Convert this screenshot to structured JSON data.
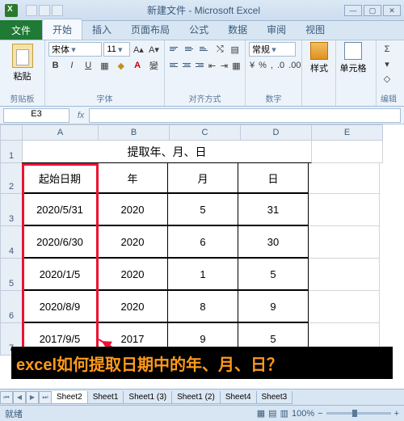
{
  "title": "新建文件 - Microsoft Excel",
  "tabs": {
    "file": "文件",
    "home": "开始",
    "insert": "插入",
    "layout": "页面布局",
    "formula": "公式",
    "data": "数据",
    "review": "审阅",
    "view": "视图"
  },
  "ribbon": {
    "clipboard": "剪贴板",
    "paste": "粘贴",
    "font_group": "字体",
    "font_name": "宋体",
    "font_size": "11",
    "align_group": "对齐方式",
    "number_group": "数字",
    "number_format": "常规",
    "style_group": "样式",
    "style_btn": "样式",
    "cells_group": "单元格",
    "cells_btn": "单元格",
    "edit_group": "编辑"
  },
  "namebox": "E3",
  "grid": {
    "cols": [
      "A",
      "B",
      "C",
      "D",
      "E"
    ],
    "rows": [
      "1",
      "2",
      "3",
      "4",
      "5",
      "6",
      "7"
    ],
    "title": "提取年、月、日",
    "headers": [
      "起始日期",
      "年",
      "月",
      "日"
    ],
    "data": [
      [
        "2020/5/31",
        "2020",
        "5",
        "31"
      ],
      [
        "2020/6/30",
        "2020",
        "6",
        "30"
      ],
      [
        "2020/1/5",
        "2020",
        "1",
        "5"
      ],
      [
        "2020/8/9",
        "2020",
        "8",
        "9"
      ],
      [
        "2017/9/5",
        "2017",
        "9",
        "5"
      ]
    ]
  },
  "sheets": [
    "Sheet2",
    "Sheet1",
    "Sheet1 (3)",
    "Sheet1 (2)",
    "Sheet4",
    "Sheet3"
  ],
  "status": "就绪",
  "zoom": "100%",
  "annotation": "excel如何提取日期中的年、月、日？",
  "chart_data": {
    "type": "table",
    "title": "提取年、月、日",
    "columns": [
      "起始日期",
      "年",
      "月",
      "日"
    ],
    "rows": [
      [
        "2020/5/31",
        2020,
        5,
        31
      ],
      [
        "2020/6/30",
        2020,
        6,
        30
      ],
      [
        "2020/1/5",
        2020,
        1,
        5
      ],
      [
        "2020/8/9",
        2020,
        8,
        9
      ],
      [
        "2017/9/5",
        2017,
        9,
        5
      ]
    ]
  }
}
